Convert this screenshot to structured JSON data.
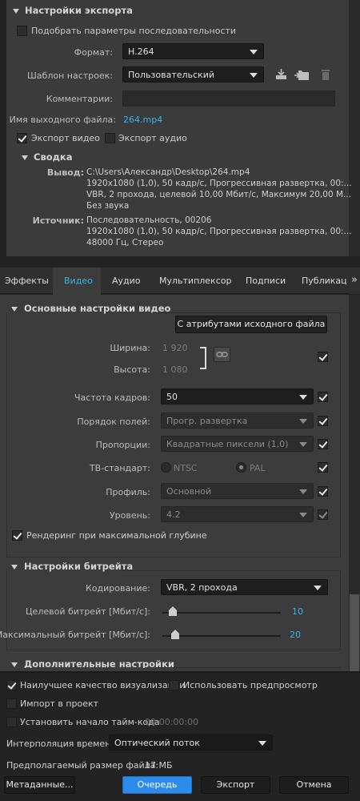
{
  "export_settings": {
    "title": "Настройки экспорта",
    "match_sequence": "Подобрать параметры последовательности",
    "format_label": "Формат:",
    "format_value": "H.264",
    "preset_label": "Шаблон настроек:",
    "preset_value": "Пользовательский",
    "comments_label": "Комментарии:",
    "output_name_label": "Имя выходного файла:",
    "output_name_value": "264.mp4",
    "export_video": "Экспорт видео",
    "export_audio": "Экспорт аудио",
    "summary_title": "Сводка",
    "output_label": "Вывод:",
    "output_lines": [
      "C:\\Users\\Александр\\Desktop\\264.mp4",
      "1920x1080 (1,0), 50 кадр/с, Прогрессивная развертка, 00:...",
      "VBR, 2 прохода, целевой 10,00 Мбит/с, Максимум 20,00 М...",
      "Без звука"
    ],
    "source_label": "Источник:",
    "source_lines": [
      "Последовательность, 00206",
      "1920x1080 (1,0), 50 кадр/с, Прогрессивная развертка, 00:...",
      "48000 Гц, Стерео"
    ]
  },
  "tabs": [
    {
      "label": "Эффекты",
      "active": false
    },
    {
      "label": "Видео",
      "active": true
    },
    {
      "label": "Аудио",
      "active": false
    },
    {
      "label": "Мультиплексор",
      "active": false
    },
    {
      "label": "Подписи",
      "active": false
    },
    {
      "label": "Публикация",
      "active": false
    }
  ],
  "tabs_overflow": "»",
  "video": {
    "basic_title": "Основные настройки видео",
    "match_source_button": "С атрибутами исходного файла",
    "width_label": "Ширина:",
    "width_value": "1 920",
    "height_label": "Высота:",
    "height_value": "1 080",
    "framerate_label": "Частота кадров:",
    "framerate_value": "50",
    "field_order_label": "Порядок полей:",
    "field_order_value": "Прогр. развертка",
    "aspect_label": "Пропорции:",
    "aspect_value": "Квадратные пиксели (1,0)",
    "tv_label": "ТВ-стандарт:",
    "tv_ntsc": "NTSC",
    "tv_pal": "PAL",
    "profile_label": "Профиль:",
    "profile_value": "Основной",
    "level_label": "Уровень:",
    "level_value": "4.2",
    "max_depth": "Рендеринг при максимальной глубине"
  },
  "bitrate": {
    "title": "Настройки битрейта",
    "encoding_label": "Кодирование:",
    "encoding_value": "VBR, 2 прохода",
    "target_label": "Целевой битрейт [Мбит/с]:",
    "target_value": "10",
    "target_fraction": 0.06,
    "max_label": "Максимальный битрейт [Мбит/с]:",
    "max_value": "20",
    "max_fraction": 0.08
  },
  "advanced_title": "Дополнительные настройки",
  "bottom": {
    "max_quality": "Наилучшее качество визуализации",
    "use_previews": "Использовать предпросмотр",
    "import_project": "Импорт в проект",
    "set_timecode": "Установить начало тайм-кода",
    "timecode_value": "00:00:00:00",
    "interp_label": "Интерполяция времени:",
    "interp_value": "Оптический поток",
    "filesize_label": "Предполагаемый размер файла:",
    "filesize_value": "17 МБ",
    "metadata_button": "Метаданные...",
    "queue_button": "Очередь",
    "export_button": "Экспорт",
    "cancel_button": "Отмена"
  },
  "colors": {
    "accent": "#39b4e6",
    "panel": "#3c3c3c",
    "background": "#232323",
    "queue_button": "#2d8ceb"
  }
}
